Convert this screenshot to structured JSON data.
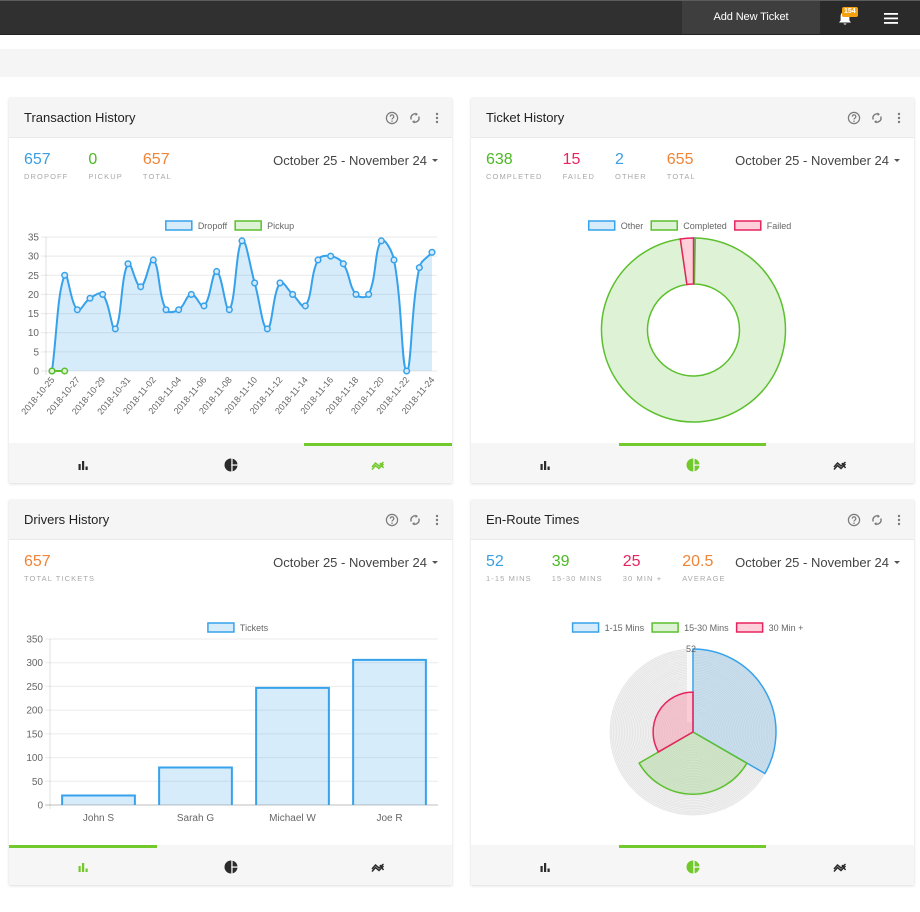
{
  "topbar": {
    "add_ticket_label": "Add New Ticket",
    "notification_count": "154"
  },
  "panels": [
    {
      "title": "Transaction History",
      "date_range": "October 25 - November 24",
      "stats": [
        {
          "value": "657",
          "label": "DROPOFF",
          "color": "#3a9fe0"
        },
        {
          "value": "0",
          "label": "PICKUP",
          "color": "#4bb824"
        },
        {
          "value": "657",
          "label": "TOTAL",
          "color": "#f08437"
        }
      ],
      "tabs": [
        {
          "type": "bar",
          "icon": "bar-chart-icon",
          "active": false
        },
        {
          "type": "pie",
          "icon": "pie-chart-icon",
          "active": false
        },
        {
          "type": "line",
          "icon": "line-chart-icon",
          "active": true
        }
      ]
    },
    {
      "title": "Ticket History",
      "date_range": "October 25 - November 24",
      "stats": [
        {
          "value": "638",
          "label": "COMPLETED",
          "color": "#4bb824"
        },
        {
          "value": "15",
          "label": "FAILED",
          "color": "#e8245f"
        },
        {
          "value": "2",
          "label": "OTHER",
          "color": "#3a9fe0"
        },
        {
          "value": "655",
          "label": "TOTAL",
          "color": "#f08437"
        }
      ],
      "tabs": [
        {
          "type": "bar",
          "icon": "bar-chart-icon",
          "active": false
        },
        {
          "type": "pie",
          "icon": "pie-chart-icon",
          "active": true
        },
        {
          "type": "line",
          "icon": "line-chart-icon",
          "active": false
        }
      ]
    },
    {
      "title": "Drivers History",
      "date_range": "October 25 - November 24",
      "stats": [
        {
          "value": "657",
          "label": "TOTAL TICKETS",
          "color": "#f08437"
        }
      ],
      "tabs": [
        {
          "type": "bar",
          "icon": "bar-chart-icon",
          "active": true
        },
        {
          "type": "pie",
          "icon": "pie-chart-icon",
          "active": false
        },
        {
          "type": "line",
          "icon": "line-chart-icon",
          "active": false
        }
      ]
    },
    {
      "title": "En-Route Times",
      "date_range": "October 25 - November 24",
      "stats": [
        {
          "value": "52",
          "label": "1-15 MINS",
          "color": "#3a9fe0"
        },
        {
          "value": "39",
          "label": "15-30 MINS",
          "color": "#4bb824"
        },
        {
          "value": "25",
          "label": "30 MIN +",
          "color": "#e8245f"
        },
        {
          "value": "20.5",
          "label": "AVERAGE",
          "color": "#f08437"
        }
      ],
      "tabs": [
        {
          "type": "bar",
          "icon": "bar-chart-icon",
          "active": false
        },
        {
          "type": "pie",
          "icon": "pie-chart-icon",
          "active": true
        },
        {
          "type": "line",
          "icon": "line-chart-icon",
          "active": false
        }
      ]
    }
  ],
  "chart_data": [
    {
      "type": "line",
      "title": "Transaction History",
      "xlabel": "",
      "ylabel": "",
      "x": [
        "2018-10-25",
        "2018-10-26",
        "2018-10-27",
        "2018-10-28",
        "2018-10-29",
        "2018-10-30",
        "2018-10-31",
        "2018-11-01",
        "2018-11-02",
        "2018-11-03",
        "2018-11-04",
        "2018-11-05",
        "2018-11-06",
        "2018-11-07",
        "2018-11-08",
        "2018-11-09",
        "2018-11-10",
        "2018-11-11",
        "2018-11-12",
        "2018-11-13",
        "2018-11-14",
        "2018-11-15",
        "2018-11-16",
        "2018-11-17",
        "2018-11-18",
        "2018-11-19",
        "2018-11-20",
        "2018-11-21",
        "2018-11-22",
        "2018-11-23",
        "2018-11-24"
      ],
      "x_tick_labels": [
        "2018-10-25",
        "2018-10-27",
        "2018-10-29",
        "2018-10-31",
        "2018-11-02",
        "2018-11-04",
        "2018-11-06",
        "2018-11-08",
        "2018-11-10",
        "2018-11-12",
        "2018-11-14",
        "2018-11-16",
        "2018-11-18",
        "2018-11-20",
        "2018-11-22",
        "2018-11-24"
      ],
      "series": [
        {
          "name": "Dropoff",
          "color": "#36a2eb",
          "fill": "rgba(54,162,235,0.2)",
          "values": [
            0,
            25,
            16,
            19,
            20,
            11,
            28,
            22,
            29,
            16,
            16,
            20,
            17,
            26,
            16,
            34,
            23,
            11,
            23,
            20,
            17,
            29,
            30,
            28,
            20,
            20,
            34,
            29,
            0,
            27,
            31
          ]
        },
        {
          "name": "Pickup",
          "color": "#5cbf2e",
          "fill": "rgba(92,191,46,0.2)",
          "values": [
            0,
            0
          ]
        }
      ],
      "ylim": [
        0,
        35
      ],
      "y_ticks": [
        0,
        5,
        10,
        15,
        20,
        25,
        30,
        35
      ],
      "grid": true,
      "legend": "top-center"
    },
    {
      "type": "pie",
      "variant": "doughnut",
      "title": "Ticket History",
      "labels": [
        "Other",
        "Completed",
        "Failed"
      ],
      "values": [
        2,
        638,
        15
      ],
      "colors": [
        "#36a2eb",
        "#5cbf2e",
        "#e5245e"
      ],
      "fills": [
        "rgba(54,162,235,0.2)",
        "rgba(92,191,46,0.2)",
        "rgba(255,99,132,0.3)"
      ],
      "legend": "top-center"
    },
    {
      "type": "bar",
      "title": "Drivers History",
      "xlabel": "",
      "ylabel": "",
      "categories": [
        "John S",
        "Sarah G",
        "Michael W",
        "Joe R"
      ],
      "series": [
        {
          "name": "Tickets",
          "color": "#36a2eb",
          "fill": "rgba(54,162,235,0.2)",
          "values": [
            20,
            79,
            247,
            306
          ]
        }
      ],
      "ylim": [
        0,
        350
      ],
      "y_ticks": [
        0,
        50,
        100,
        150,
        200,
        250,
        300,
        350
      ],
      "grid": true,
      "legend": "top-center"
    },
    {
      "type": "pie",
      "variant": "polarArea",
      "title": "En-Route Times",
      "labels": [
        "1-15 Mins",
        "15-30 Mins",
        "30 Min +"
      ],
      "values": [
        52,
        39,
        25
      ],
      "colors": [
        "#36a2eb",
        "#5cbf2e",
        "#e5245e"
      ],
      "fills": [
        "rgba(54,162,235,0.2)",
        "rgba(92,191,46,0.2)",
        "rgba(255,99,132,0.3)"
      ],
      "radial_max": 52,
      "radial_tick_label": "52",
      "legend": "top-center"
    }
  ]
}
